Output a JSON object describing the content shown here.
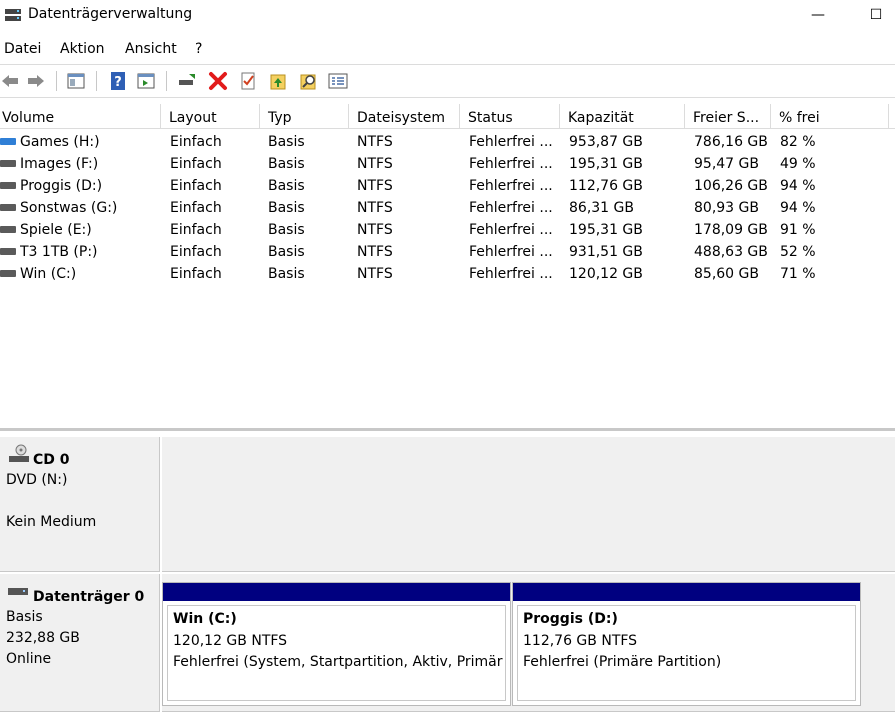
{
  "window": {
    "title": "Datenträgerverwaltung",
    "minimize": "—",
    "maximize": "☐"
  },
  "menu": [
    "Datei",
    "Aktion",
    "Ansicht",
    "?"
  ],
  "toolbar": {
    "icons": [
      "back-icon",
      "forward-icon",
      "console-tree-icon",
      "help-icon",
      "action-pane-icon",
      "connect-disk-icon",
      "delete-icon",
      "check-icon",
      "import-icon",
      "find-icon",
      "properties-icon"
    ],
    "delete_color": "#e21b1b"
  },
  "volume_list": {
    "columns": [
      "Volume",
      "Layout",
      "Typ",
      "Dateisystem",
      "Status",
      "Kapazität",
      "Freier S...",
      "% frei"
    ],
    "rows": [
      [
        "Games (H:)",
        "Einfach",
        "Basis",
        "NTFS",
        "Fehlerfrei ...",
        "953,87 GB",
        "786,16 GB",
        "82 %"
      ],
      [
        "Images (F:)",
        "Einfach",
        "Basis",
        "NTFS",
        "Fehlerfrei ...",
        "195,31 GB",
        "95,47 GB",
        "49 %"
      ],
      [
        "Proggis (D:)",
        "Einfach",
        "Basis",
        "NTFS",
        "Fehlerfrei ...",
        "112,76 GB",
        "106,26 GB",
        "94 %"
      ],
      [
        "Sonstwas (G:)",
        "Einfach",
        "Basis",
        "NTFS",
        "Fehlerfrei ...",
        "86,31 GB",
        "80,93 GB",
        "94 %"
      ],
      [
        "Spiele (E:)",
        "Einfach",
        "Basis",
        "NTFS",
        "Fehlerfrei ...",
        "195,31 GB",
        "178,09 GB",
        "91 %"
      ],
      [
        "T3 1TB (P:)",
        "Einfach",
        "Basis",
        "NTFS",
        "Fehlerfrei ...",
        "931,51 GB",
        "488,63 GB",
        "52 %"
      ],
      [
        "Win (C:)",
        "Einfach",
        "Basis",
        "NTFS",
        "Fehlerfrei ...",
        "120,12 GB",
        "85,60 GB",
        "71 %"
      ]
    ]
  },
  "disks": {
    "cd0": {
      "name": "CD 0",
      "drive": "DVD (N:)",
      "media": "Kein Medium"
    },
    "disk0": {
      "name": "Datenträger 0",
      "type": "Basis",
      "size": "232,88 GB",
      "status": "Online",
      "partitions": [
        {
          "name": "Win  (C:)",
          "size": "120,12 GB NTFS",
          "status": "Fehlerfrei (System, Startpartition, Aktiv, Primäre"
        },
        {
          "name": "Proggis  (D:)",
          "size": "112,76 GB NTFS",
          "status": "Fehlerfrei (Primäre Partition)"
        }
      ]
    }
  },
  "colors": {
    "partition_bar": "#000080",
    "selection": "#2f7fd6"
  }
}
